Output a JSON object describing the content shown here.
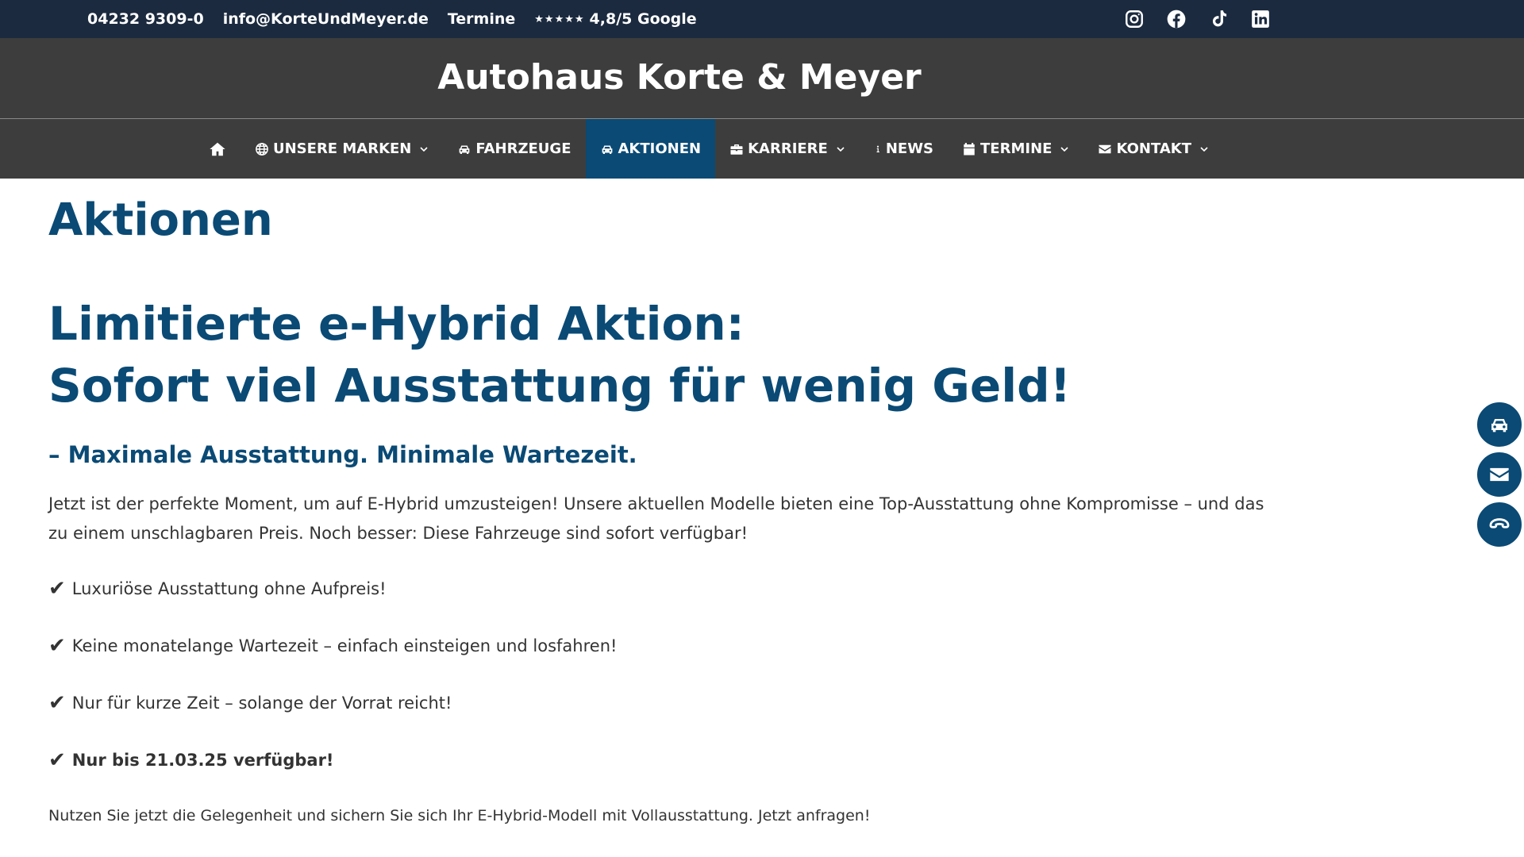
{
  "topbar": {
    "phone": "04232 9309-0",
    "email": "info@KorteUndMeyer.de",
    "termine": "Termine",
    "stars": "★★★★★",
    "rating": "4,8/5 Google",
    "social_icons": [
      "instagram-icon",
      "facebook-icon",
      "tiktok-icon",
      "linkedin-icon"
    ]
  },
  "brand": {
    "title": "Autohaus Korte & Meyer"
  },
  "nav": {
    "home_icon": "home-icon",
    "items": [
      {
        "label": "UNSERE MARKEN",
        "icon": "globe-icon",
        "dropdown": true
      },
      {
        "label": "FAHRZEUGE",
        "icon": "car-icon",
        "dropdown": false
      },
      {
        "label": "AKTIONEN",
        "icon": "car-icon",
        "dropdown": false,
        "active": true
      },
      {
        "label": "KARRIERE",
        "icon": "briefcase-icon",
        "dropdown": true
      },
      {
        "label": "NEWS",
        "icon": "info-icon",
        "dropdown": false
      },
      {
        "label": "TERMINE",
        "icon": "calendar-icon",
        "dropdown": true
      },
      {
        "label": "KONTAKT",
        "icon": "envelope-icon",
        "dropdown": true
      }
    ]
  },
  "main": {
    "page_title": "Aktionen",
    "headline_line1": "Limitierte e-Hybrid Aktion:",
    "headline_line2": "Sofort viel Ausstattung für wenig Geld!",
    "subheadline": "– Maximale Ausstattung. Minimale Wartezeit.",
    "intro": "Jetzt ist der perfekte Moment, um auf E-Hybrid umzusteigen! Unsere aktuellen Modelle bieten eine Top-Ausstattung ohne Kompromisse – und das zu einem unschlagbaren Preis. Noch besser: Diese Fahrzeuge sind sofort verfügbar!",
    "check_mark": "✔",
    "checks": [
      "Luxuriöse Ausstattung ohne Aufpreis!",
      "Keine monatelange Wartezeit – einfach einsteigen und losfahren!",
      "Nur für kurze Zeit – solange der Vorrat reicht!",
      "Nur bis 21.03.25 verfügbar!"
    ],
    "cta": "Nutzen Sie jetzt die Gelegenheit und sichern Sie sich Ihr E-Hybrid-Modell mit Vollausstattung. Jetzt anfragen!"
  },
  "floating": {
    "icons": [
      "car-icon",
      "envelope-icon",
      "phone-icon"
    ]
  },
  "colors": {
    "topbar": "#1b2a3f",
    "header": "#3d3d3d",
    "accent": "#0a4a75",
    "text": "#333333"
  }
}
